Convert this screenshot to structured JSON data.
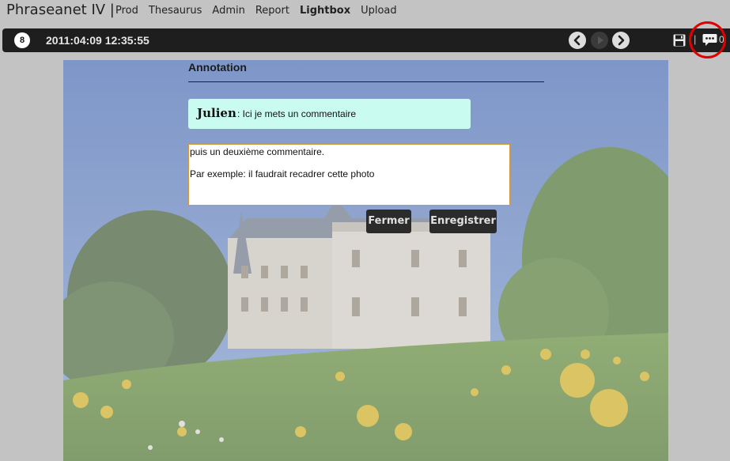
{
  "app": {
    "title": "Phraseanet IV |",
    "nav": [
      {
        "label": "Prod",
        "active": false
      },
      {
        "label": "Thesaurus",
        "active": false
      },
      {
        "label": "Admin",
        "active": false
      },
      {
        "label": "Report",
        "active": false
      },
      {
        "label": "Lightbox",
        "active": true
      },
      {
        "label": "Upload",
        "active": false
      }
    ]
  },
  "toolbar": {
    "counter": "8",
    "datetime": "2011:04:09 12:35:55",
    "separator": "|",
    "comment_count": "0",
    "icons": [
      "previous-icon",
      "play-icon",
      "next-icon",
      "save-icon",
      "comments-icon"
    ]
  },
  "annotation": {
    "title": "Annotation",
    "comment": {
      "author": "Julien",
      "text": ": Ici je mets un commentaire"
    },
    "input_value": "puis un deuxième commentaire.\n\nPar exemple: il faudrait recadrer cette photo",
    "close_label": "Fermer",
    "save_label": "Enregistrer"
  },
  "colors": {
    "toolbar_bg": "#1e1e1e",
    "comment_bg": "#c9fbf0",
    "highlight": "#e00000",
    "input_border": "#d49a3a"
  }
}
